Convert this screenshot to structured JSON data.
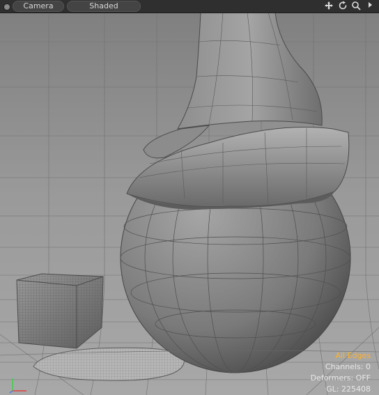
{
  "toolbar": {
    "camera_label": "Camera",
    "shading_label": "Shaded"
  },
  "icons": {
    "pan": "move-icon",
    "rotate": "rotate-icon",
    "zoom": "zoom-icon",
    "menu": "arrow-right-icon"
  },
  "status": {
    "selection_mode": "All Edges",
    "channels": "Channels: 0",
    "deformers": "Deformers: OFF",
    "gl": "GL: 225408"
  },
  "colors": {
    "selection_mode": "#ffb428",
    "background": "#8a8a8a"
  }
}
